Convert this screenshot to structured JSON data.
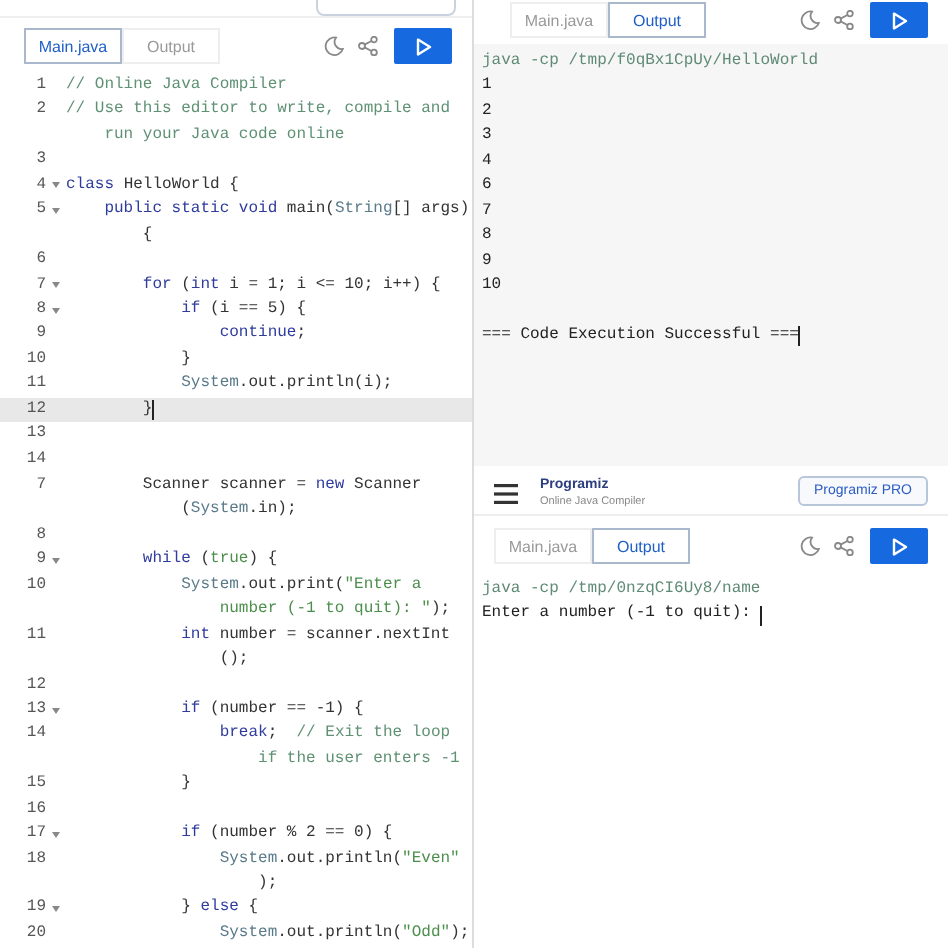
{
  "panels": [
    {
      "kind": "editor",
      "header": {
        "kind": "cut"
      },
      "tabs": [
        {
          "label": "Main.java",
          "selected": true
        },
        {
          "label": "Output",
          "selected": false
        }
      ],
      "lines": [
        {
          "number": "1",
          "fold": false,
          "current": false,
          "rows": [
            {
              "parts": [
                {
                  "kind": "comment",
                  "text": "// Online Java Compiler"
                }
              ]
            }
          ]
        },
        {
          "number": "2",
          "fold": false,
          "current": false,
          "rows": [
            {
              "parts": [
                {
                  "kind": "comment",
                  "text": "// Use this editor to write, compile and"
                }
              ]
            },
            {
              "parts": [
                {
                  "kind": "comment",
                  "text": "    run your Java code online"
                }
              ]
            }
          ]
        },
        {
          "number": "3",
          "fold": false,
          "current": false
        },
        {
          "number": "4",
          "fold": true,
          "current": false,
          "rows": [
            {
              "parts": [
                {
                  "kind": "keyword",
                  "text": "class"
                },
                {
                  "kind": "plain",
                  "text": " HelloWorld {"
                }
              ]
            }
          ]
        },
        {
          "number": "5",
          "fold": true,
          "current": false,
          "rows": [
            {
              "parts": [
                {
                  "kind": "keyword",
                  "text": "    public static void"
                },
                {
                  "kind": "plain",
                  "text": " main("
                },
                {
                  "kind": "type",
                  "text": "String"
                },
                {
                  "kind": "plain",
                  "text": "[] args)"
                }
              ]
            },
            {
              "parts": [
                {
                  "kind": "plain",
                  "text": "        {"
                }
              ]
            }
          ]
        },
        {
          "number": "6",
          "fold": false,
          "current": false
        },
        {
          "number": "7",
          "fold": true,
          "current": false,
          "rows": [
            {
              "parts": [
                {
                  "kind": "keyword",
                  "text": "        for"
                },
                {
                  "kind": "plain",
                  "text": " ("
                },
                {
                  "kind": "keyword",
                  "text": "int"
                },
                {
                  "kind": "plain",
                  "text": " i = 1; i <= 10; i++) {"
                }
              ]
            }
          ]
        },
        {
          "number": "8",
          "fold": true,
          "current": false,
          "rows": [
            {
              "parts": [
                {
                  "kind": "keyword",
                  "text": "            if"
                },
                {
                  "kind": "plain",
                  "text": " (i == 5) {"
                }
              ]
            }
          ]
        },
        {
          "number": "9",
          "fold": false,
          "current": false,
          "rows": [
            {
              "parts": [
                {
                  "kind": "keyword",
                  "text": "                continue"
                },
                {
                  "kind": "plain",
                  "text": ";"
                }
              ]
            }
          ]
        },
        {
          "number": "10",
          "fold": false,
          "current": false,
          "rows": [
            {
              "parts": [
                {
                  "kind": "plain",
                  "text": "            }"
                }
              ]
            }
          ]
        },
        {
          "number": "11",
          "fold": false,
          "current": false,
          "rows": [
            {
              "parts": [
                {
                  "kind": "type",
                  "text": "            System"
                },
                {
                  "kind": "plain",
                  "text": ".out.println(i);"
                }
              ]
            }
          ]
        },
        {
          "number": "12",
          "fold": false,
          "current": true,
          "cursor": true,
          "rows": [
            {
              "parts": [
                {
                  "kind": "plain",
                  "text": "        }"
                }
              ]
            }
          ]
        },
        {
          "number": "13",
          "fold": false,
          "current": false
        },
        {
          "number": "14",
          "fold": false,
          "current": false
        }
      ]
    },
    {
      "kind": "editor",
      "lines": [
        {
          "number": "7",
          "fold": false,
          "current": false,
          "rows": [
            {
              "parts": [
                {
                  "kind": "plain",
                  "text": "        Scanner scanner = "
                },
                {
                  "kind": "keyword",
                  "text": "new"
                },
                {
                  "kind": "plain",
                  "text": " Scanner"
                }
              ]
            },
            {
              "parts": [
                {
                  "kind": "plain",
                  "text": "            ("
                },
                {
                  "kind": "type",
                  "text": "System"
                },
                {
                  "kind": "plain",
                  "text": ".in);"
                }
              ]
            }
          ]
        },
        {
          "number": "8",
          "fold": false,
          "current": false
        },
        {
          "number": "9",
          "fold": true,
          "current": false,
          "rows": [
            {
              "parts": [
                {
                  "kind": "keyword",
                  "text": "        while"
                },
                {
                  "kind": "plain",
                  "text": " ("
                },
                {
                  "kind": "literal",
                  "text": "true"
                },
                {
                  "kind": "plain",
                  "text": ") {"
                }
              ]
            }
          ]
        },
        {
          "number": "10",
          "fold": false,
          "current": false,
          "rows": [
            {
              "parts": [
                {
                  "kind": "type",
                  "text": "            System"
                },
                {
                  "kind": "plain",
                  "text": ".out.print("
                },
                {
                  "kind": "string",
                  "text": "\"Enter a"
                }
              ]
            },
            {
              "parts": [
                {
                  "kind": "string",
                  "text": "                number (-1 to quit): \""
                },
                {
                  "kind": "plain",
                  "text": ");"
                }
              ]
            }
          ]
        },
        {
          "number": "11",
          "fold": false,
          "current": false,
          "rows": [
            {
              "parts": [
                {
                  "kind": "keyword",
                  "text": "            int"
                },
                {
                  "kind": "plain",
                  "text": " number = scanner.nextInt"
                }
              ]
            },
            {
              "parts": [
                {
                  "kind": "plain",
                  "text": "                ();"
                }
              ]
            }
          ]
        },
        {
          "number": "12",
          "fold": false,
          "current": false
        },
        {
          "number": "13",
          "fold": true,
          "current": false,
          "rows": [
            {
              "parts": [
                {
                  "kind": "keyword",
                  "text": "            if"
                },
                {
                  "kind": "plain",
                  "text": " (number == -1) {"
                }
              ]
            }
          ]
        },
        {
          "number": "14",
          "fold": false,
          "current": false,
          "rows": [
            {
              "parts": [
                {
                  "kind": "keyword",
                  "text": "                break"
                },
                {
                  "kind": "plain",
                  "text": ";  "
                },
                {
                  "kind": "comment",
                  "text": "// Exit the loop"
                }
              ]
            },
            {
              "parts": [
                {
                  "kind": "comment",
                  "text": "                    if the user enters -1"
                }
              ]
            }
          ]
        },
        {
          "number": "15",
          "fold": false,
          "current": false,
          "rows": [
            {
              "parts": [
                {
                  "kind": "plain",
                  "text": "            }"
                }
              ]
            }
          ]
        },
        {
          "number": "16",
          "fold": false,
          "current": false
        },
        {
          "number": "17",
          "fold": true,
          "current": false,
          "rows": [
            {
              "parts": [
                {
                  "kind": "keyword",
                  "text": "            if"
                },
                {
                  "kind": "plain",
                  "text": " (number % 2 == 0) {"
                }
              ]
            }
          ]
        },
        {
          "number": "18",
          "fold": false,
          "current": false,
          "rows": [
            {
              "parts": [
                {
                  "kind": "type",
                  "text": "                System"
                },
                {
                  "kind": "plain",
                  "text": ".out.println("
                },
                {
                  "kind": "string",
                  "text": "\"Even\""
                }
              ]
            },
            {
              "parts": [
                {
                  "kind": "plain",
                  "text": "                    );"
                }
              ]
            }
          ]
        },
        {
          "number": "19",
          "fold": true,
          "current": false,
          "rows": [
            {
              "parts": [
                {
                  "kind": "plain",
                  "text": "            } "
                },
                {
                  "kind": "keyword",
                  "text": "else"
                },
                {
                  "kind": "plain",
                  "text": " {"
                }
              ]
            }
          ]
        },
        {
          "number": "20",
          "fold": false,
          "current": false,
          "rows": [
            {
              "parts": [
                {
                  "kind": "type",
                  "text": "                System"
                },
                {
                  "kind": "plain",
                  "text": ".out.println("
                },
                {
                  "kind": "string",
                  "text": "\"Odd\""
                },
                {
                  "kind": "plain",
                  "text": ");"
                }
              ]
            }
          ]
        }
      ]
    },
    {
      "kind": "output",
      "tabs": [
        {
          "label": "Main.java",
          "selected": false
        },
        {
          "label": "Output",
          "selected": true
        }
      ],
      "output": [
        {
          "kind": "command",
          "text": "java -cp /tmp/f0qBx1CpUy/HelloWorld"
        },
        {
          "kind": "text",
          "text": "1"
        },
        {
          "kind": "text",
          "text": "2"
        },
        {
          "kind": "text",
          "text": "3"
        },
        {
          "kind": "text",
          "text": "4"
        },
        {
          "kind": "text",
          "text": "6"
        },
        {
          "kind": "text",
          "text": "7"
        },
        {
          "kind": "text",
          "text": "8"
        },
        {
          "kind": "text",
          "text": "9"
        },
        {
          "kind": "text",
          "text": "10"
        },
        {
          "kind": "blank"
        },
        {
          "kind": "text",
          "text": "=== Code Execution Successful ===",
          "cursor": true
        }
      ]
    },
    {
      "kind": "output",
      "header": {
        "kind": "full",
        "logo": "Programiz",
        "subtitle": "Online Java Compiler",
        "button": "Programiz PRO"
      },
      "tabs": [
        {
          "label": "Main.java",
          "selected": false
        },
        {
          "label": "Output",
          "selected": true
        }
      ],
      "output": [
        {
          "kind": "command",
          "text": "java -cp /tmp/0nzqCI6Uy8/name"
        },
        {
          "kind": "text",
          "text": "Enter a number (-1 to quit): ",
          "cursor": true
        }
      ]
    }
  ]
}
